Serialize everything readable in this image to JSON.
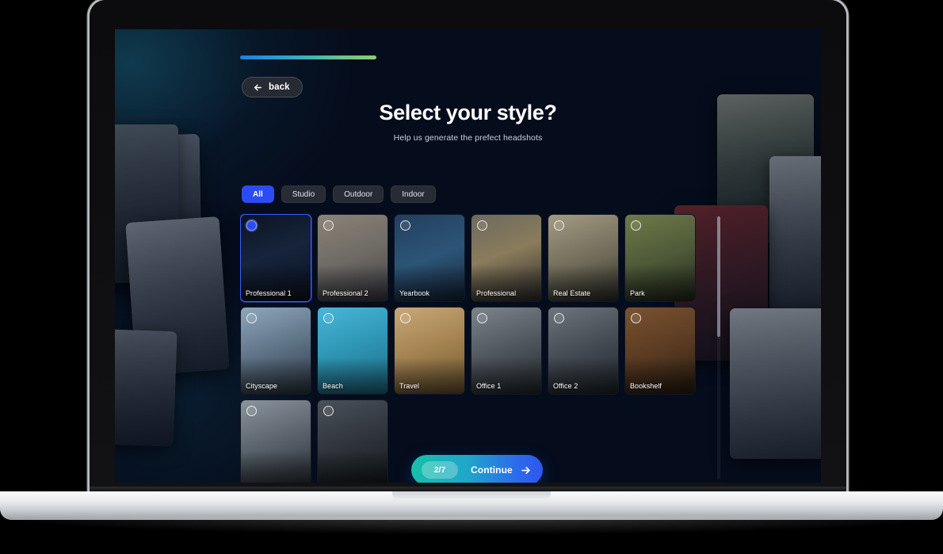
{
  "app": {
    "background_color": "#050c1c",
    "accent_color": "#2b4cf2"
  },
  "header": {
    "progress_percent": 100,
    "progress_gradient": [
      "#1f7fe0",
      "#3fb6b4",
      "#8fcc6e"
    ],
    "back_label": "back",
    "back_icon": "arrow-left-icon",
    "title": "Select your style?",
    "subtitle": "Help us generate the prefect headshots"
  },
  "filters": [
    {
      "label": "All",
      "active": true
    },
    {
      "label": "Studio",
      "active": false
    },
    {
      "label": "Outdoor",
      "active": false
    },
    {
      "label": "Indoor",
      "active": false
    }
  ],
  "styles": [
    {
      "label": "Professional 1",
      "selected": true,
      "bg": "linear-gradient(160deg,#0d1422 0%,#16243c 45%,#0a1120 100%)"
    },
    {
      "label": "Professional 2",
      "selected": false,
      "bg": "linear-gradient(160deg,#8b8378 0%,#6e6a64 50%,#3b3d46 100%)"
    },
    {
      "label": "Yearbook",
      "selected": false,
      "bg": "linear-gradient(160deg,#23405e 0%,#2d5577 50%,#14243a 100%)"
    },
    {
      "label": "Professional",
      "selected": false,
      "bg": "linear-gradient(160deg,#6d6a5e 0%,#8a7c5c 45%,#2f2e2c 100%)"
    },
    {
      "label": "Real Estate",
      "selected": false,
      "bg": "linear-gradient(160deg,#a39a82 0%,#6f6a58 55%,#2c2e28 100%)"
    },
    {
      "label": "Park",
      "selected": false,
      "bg": "linear-gradient(160deg,#6f7a4a 0%,#4e5a38 50%,#23281c 100%)"
    },
    {
      "label": "Cityscape",
      "selected": false,
      "bg": "linear-gradient(160deg,#8fa6bb 0%,#5d7184 50%,#2b3742 100%)"
    },
    {
      "label": "Beach",
      "selected": false,
      "bg": "linear-gradient(160deg,#49b6d8 0%,#2f97b6 45%,#1d6a84 100%)"
    },
    {
      "label": "Travel",
      "selected": false,
      "bg": "linear-gradient(160deg,#c9a878 0%,#a2814f 50%,#6b5430 100%)"
    },
    {
      "label": "Office 1",
      "selected": false,
      "bg": "linear-gradient(160deg,#7d858c 0%,#4e555c 50%,#23282d 100%)"
    },
    {
      "label": "Office 2",
      "selected": false,
      "bg": "linear-gradient(160deg,#6d757c 0%,#434a52 50%,#1f242a 100%)"
    },
    {
      "label": "Bookshelf",
      "selected": false,
      "bg": "linear-gradient(160deg,#7a5230 0%,#5a3b22 50%,#2a1c11 100%)"
    },
    {
      "label": "",
      "selected": false,
      "bg": "linear-gradient(160deg,#8b949c 0%,#58616a 50%,#272c33 100%)"
    },
    {
      "label": "",
      "selected": false,
      "bg": "linear-gradient(160deg,#4a5159 0%,#2f343b 50%,#14181d 100%)"
    }
  ],
  "footer": {
    "step_badge": "2/7",
    "continue_label": "Continue",
    "continue_icon": "arrow-right-icon"
  },
  "scrollbar": {
    "visible": true
  }
}
